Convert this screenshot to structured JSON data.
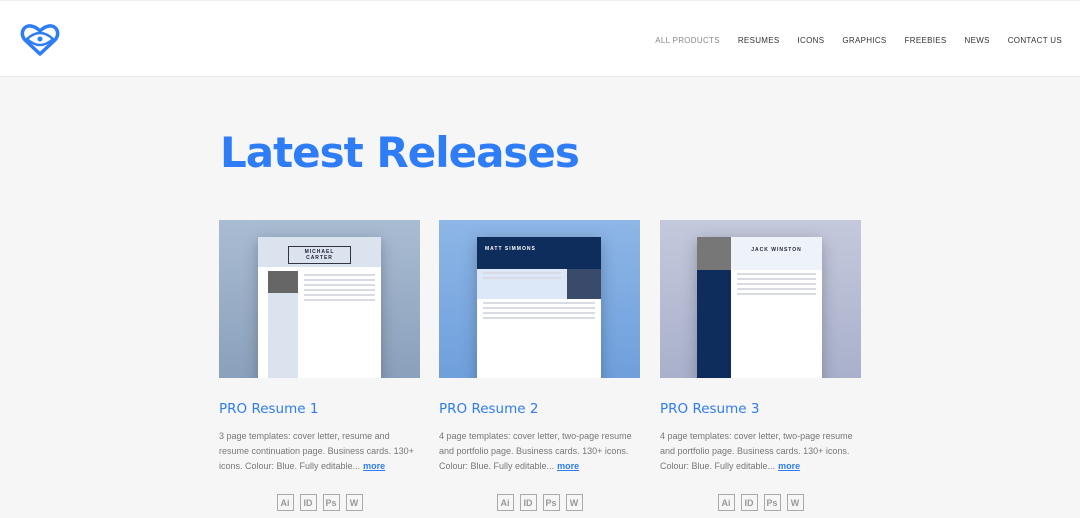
{
  "nav": [
    "All Products",
    "Resumes",
    "Icons",
    "Graphics",
    "Freebies",
    "News",
    "Contact Us"
  ],
  "heading": "Latest Releases",
  "colors": {
    "accent": "#2e7cf6"
  },
  "products": [
    {
      "title": "PRO Resume 1",
      "desc": "3 page templates: cover letter, resume and resume continuation page. Business cards. 130+ icons. Colour: Blue. Fully editable...",
      "more": "more",
      "preview_name": "MICHAEL CARTER",
      "formats": [
        "Ai",
        "ID",
        "Ps",
        "W"
      ]
    },
    {
      "title": "PRO Resume 2",
      "desc": "4 page templates: cover letter, two-page resume and portfolio page. Business cards. 130+ icons. Colour: Blue. Fully editable...",
      "more": "more",
      "preview_name": "MATT SIMMONS",
      "formats": [
        "Ai",
        "ID",
        "Ps",
        "W"
      ]
    },
    {
      "title": "PRO Resume 3",
      "desc": "4 page templates: cover letter, two-page resume and portfolio page. Business cards. 130+ icons. Colour: Blue. Fully editable...",
      "more": "more",
      "preview_name": "JACK WINSTON",
      "formats": [
        "Ai",
        "ID",
        "Ps",
        "W"
      ]
    }
  ]
}
